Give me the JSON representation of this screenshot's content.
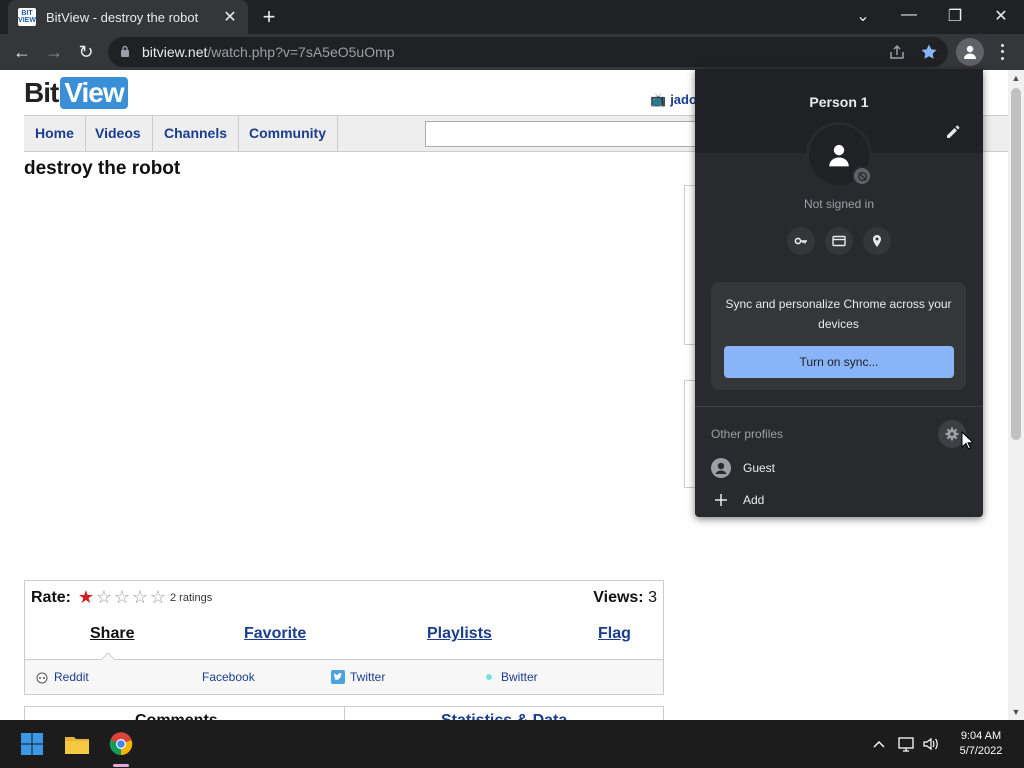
{
  "browser": {
    "tab_title": "BitView - destroy the robot",
    "tab_favicon_text": "BIT VIEW",
    "url_host": "bitview.net",
    "url_path": "/watch.php?v=7sA5eO5uOmp"
  },
  "site": {
    "logo_bit": "Bit",
    "logo_view": "View",
    "user_link": "jadoo",
    "nav": [
      "Home",
      "Videos",
      "Channels",
      "Community"
    ],
    "video_title": "destroy the robot",
    "rate_label": "Rate:",
    "rating_stars": 1,
    "rating_max": 5,
    "ratings_count": "2 ratings",
    "views_label": "Views:",
    "views_value": "3",
    "panel_tabs": [
      "Share",
      "Favorite",
      "Playlists",
      "Flag"
    ],
    "share_links": [
      "Reddit",
      "Facebook",
      "Twitter",
      "Bwitter"
    ],
    "bottom_tabs": [
      "Comments",
      "Statistics & Data"
    ]
  },
  "profile_menu": {
    "name": "Person 1",
    "status": "Not signed in",
    "sync_text": "Sync and personalize Chrome across your devices",
    "sync_button": "Turn on sync...",
    "other_profiles_label": "Other profiles",
    "guest_label": "Guest",
    "add_label": "Add"
  },
  "taskbar": {
    "time": "9:04 AM",
    "date": "5/7/2022"
  },
  "colors": {
    "accent": "#8ab4f8",
    "link": "#1a3d8f",
    "star_filled": "#d11f1f",
    "chrome_dark": "#202124"
  },
  "icons": [
    "back-icon",
    "forward-icon",
    "reload-icon",
    "lock-icon",
    "share-icon",
    "bookmark-star-icon",
    "profile-icon",
    "kebab-menu-icon",
    "edit-pencil-icon",
    "key-icon",
    "card-icon",
    "location-pin-icon",
    "gear-icon",
    "guest-icon",
    "plus-icon",
    "windows-start-icon",
    "file-explorer-icon",
    "chrome-icon"
  ]
}
